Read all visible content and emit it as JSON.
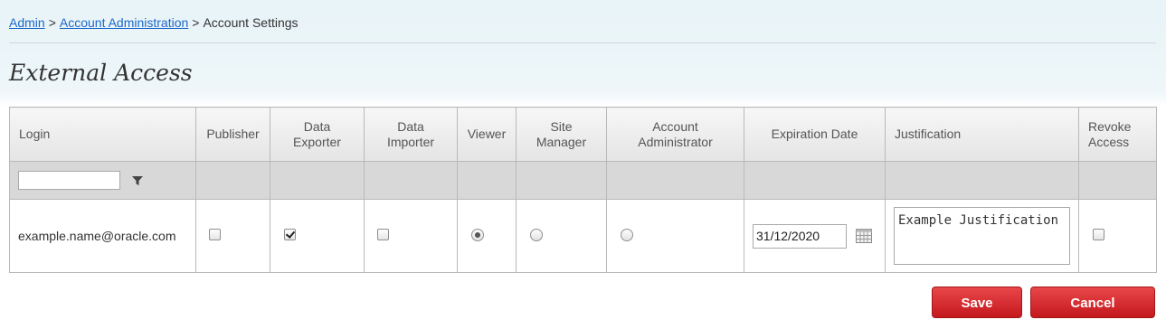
{
  "breadcrumb": {
    "items": [
      "Admin",
      "Account Administration"
    ],
    "current": "Account Settings",
    "separator": ">"
  },
  "page": {
    "title": "External Access"
  },
  "table": {
    "headers": {
      "login": "Login",
      "publisher": "Publisher",
      "data_exporter": [
        "Data",
        "Exporter"
      ],
      "data_importer": [
        "Data",
        "Importer"
      ],
      "viewer": "Viewer",
      "site_manager": [
        "Site",
        "Manager"
      ],
      "account_administrator": [
        "Account",
        "Administrator"
      ],
      "expiration_date": "Expiration Date",
      "justification": "Justification",
      "revoke_access": [
        "Revoke",
        "Access"
      ]
    },
    "filter": {
      "login_value": "",
      "filter_icon": "filter-icon"
    },
    "row": {
      "login": "example.name@oracle.com",
      "publisher": false,
      "data_exporter": true,
      "data_importer": false,
      "role_selected": "viewer",
      "expiration_date": "31/12/2020",
      "justification": "Example Justification",
      "revoke_access": false
    }
  },
  "buttons": {
    "save": "Save",
    "cancel": "Cancel"
  },
  "colors": {
    "link": "#1b67c9",
    "button": "#d42a2e",
    "header_bg": "#e8f4f8"
  }
}
